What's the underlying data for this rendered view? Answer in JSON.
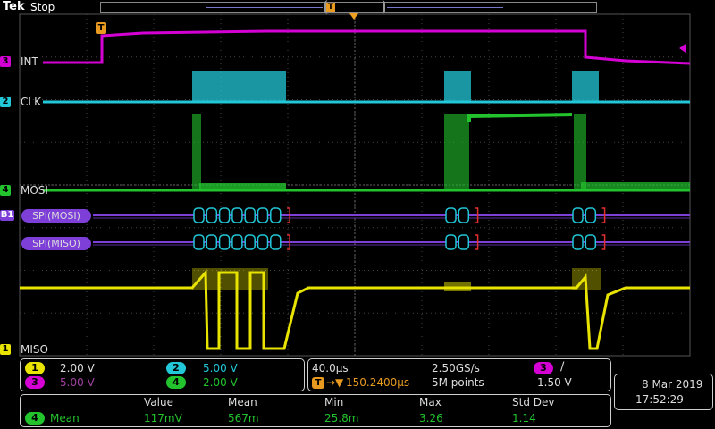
{
  "header": {
    "brand": "Tek",
    "status": "Stop",
    "trigger_marker": "T"
  },
  "channels": {
    "ch3": {
      "num": "3",
      "label": "INT",
      "color": "#d400d4"
    },
    "ch2": {
      "num": "2",
      "label": "CLK",
      "color": "#22c8d8"
    },
    "ch4": {
      "num": "4",
      "label": "MOSI",
      "color": "#22c32d"
    },
    "bus1": {
      "num": "B1",
      "label": "SPI(MOSI)",
      "color": "#7d3fd8"
    },
    "bus2": {
      "label": "SPI(MISO)",
      "color": "#7d3fd8"
    },
    "ch1": {
      "num": "1",
      "label": "MISO",
      "color": "#e8e400"
    }
  },
  "vertical_panel": {
    "ch1": {
      "num": "1",
      "value": "2.00 V"
    },
    "ch3": {
      "num": "3",
      "value": "5.00 V"
    },
    "ch2": {
      "num": "2",
      "value": "5.00 V"
    },
    "ch4": {
      "num": "4",
      "value": "2.00 V"
    }
  },
  "horizontal_panel": {
    "timebase": "40.0µs",
    "sample_rate": "2.50GS/s",
    "trigger_pos_marker": "T",
    "trigger_position": "150.2400µs",
    "record_length": "5M points"
  },
  "trigger_panel": {
    "source": "3",
    "slope": "∕",
    "level": "1.50 V"
  },
  "datetime": {
    "date": "8 Mar  2019",
    "time": "17:52:29"
  },
  "measurements": {
    "source": "4",
    "name": "Mean",
    "headers": [
      "Value",
      "Mean",
      "Min",
      "Max",
      "Std Dev"
    ],
    "values": [
      "117mV",
      "567m",
      "25.8m",
      "3.26",
      "1.14"
    ]
  }
}
